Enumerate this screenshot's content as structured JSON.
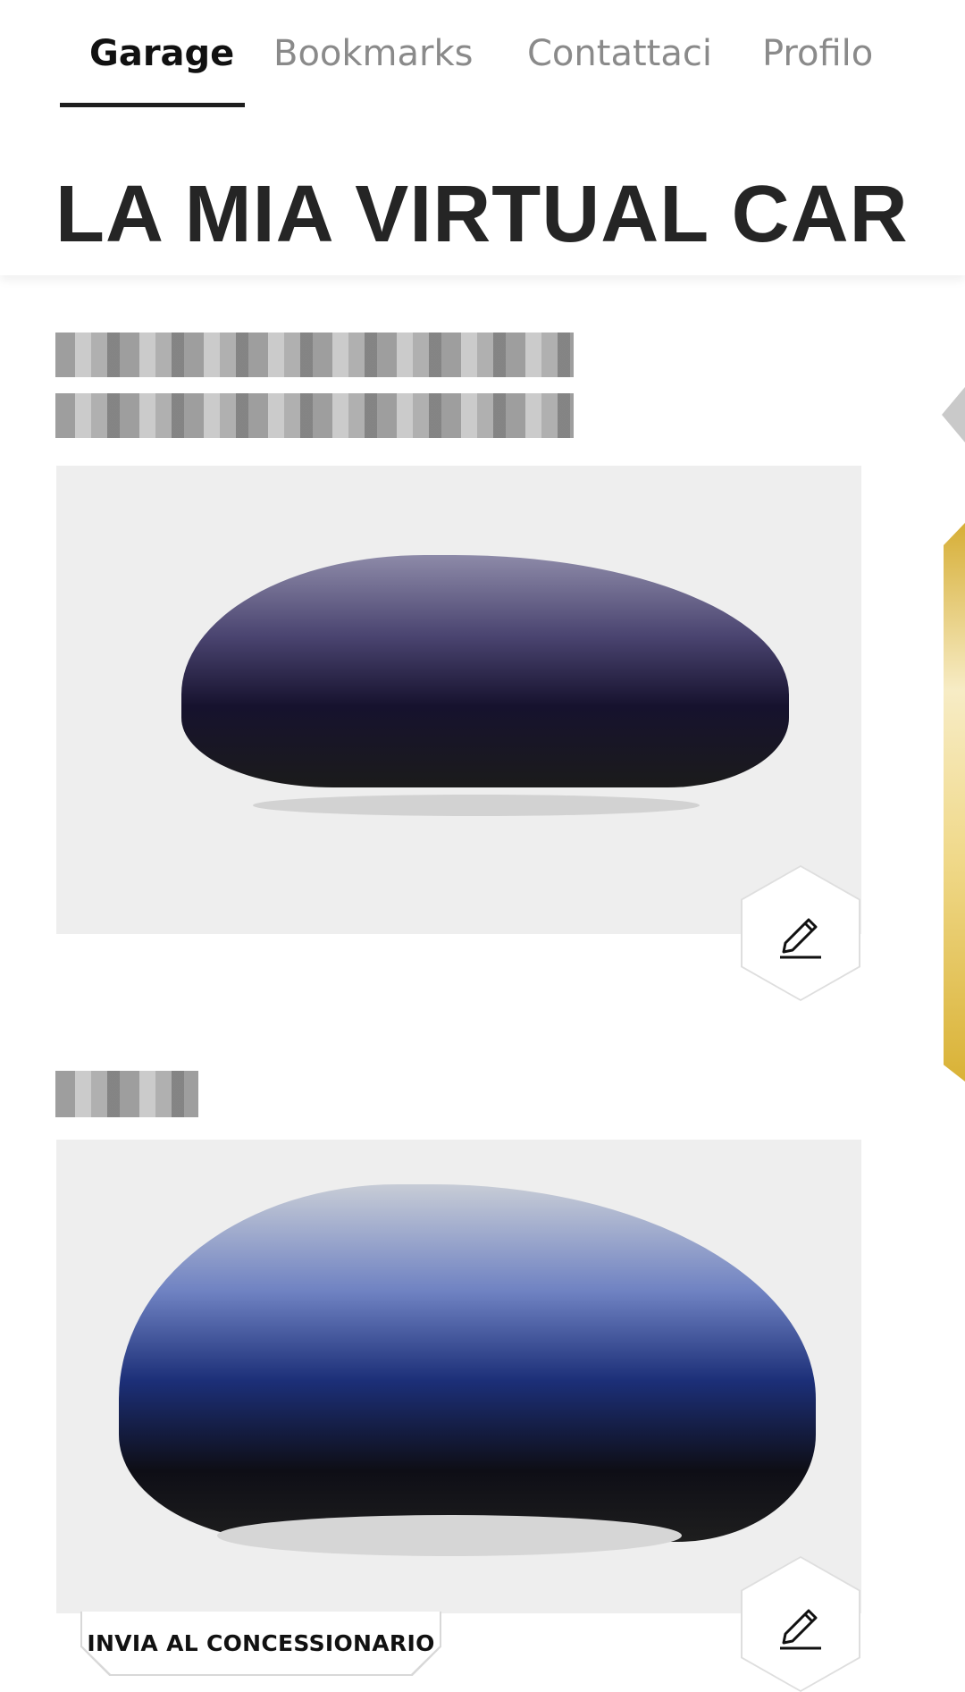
{
  "tabs": [
    {
      "label": "Garage",
      "active": true
    },
    {
      "label": "Bookmarks",
      "active": false
    },
    {
      "label": "Contattaci",
      "active": false
    },
    {
      "label": "Profilo",
      "active": false
    }
  ],
  "page_title": "LA MIA VIRTUAL CAR",
  "cards": [
    {
      "edit_icon": "pencil-icon"
    },
    {
      "edit_icon": "pencil-icon",
      "send_label": "INVIA AL CONCESSIONARIO"
    }
  ],
  "colors": {
    "accent_gold": "#d6ae35",
    "title_text": "#252525",
    "card_bg": "#eeeeee"
  }
}
